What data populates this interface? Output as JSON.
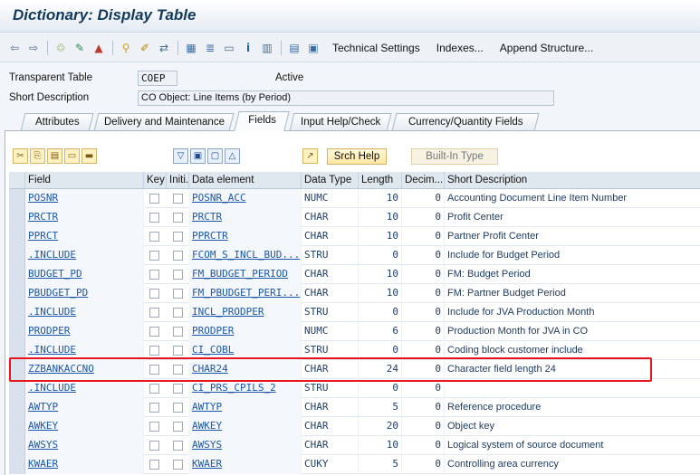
{
  "window": {
    "title": "Dictionary: Display Table"
  },
  "toolbar": {
    "icons": [
      "back-arrow-icon",
      "forward-arrow-icon",
      "other-object-icon",
      "display-change-icon",
      "activate-icon",
      "where-used-icon",
      "edit-object-icon",
      "object-list-icon",
      "hierarchy-icon",
      "graphic-icon",
      "info-icon",
      "display-object-list-icon"
    ],
    "technical_settings": "Technical Settings",
    "indexes": "Indexes...",
    "append_structure": "Append Structure..."
  },
  "header": {
    "table_type_label": "Transparent Table",
    "table_name": "COEP",
    "status": "Active",
    "short_desc_label": "Short Description",
    "short_desc": "CO Object: Line Items (by Period)"
  },
  "tabs": [
    "Attributes",
    "Delivery and Maintenance",
    "Fields",
    "Input Help/Check",
    "Currency/Quantity Fields"
  ],
  "active_tab": "Fields",
  "table_toolbar": {
    "srch_help": "Srch Help",
    "built_in_type": "Built-In Type"
  },
  "columns": [
    "Field",
    "Key",
    "Initi...",
    "Data element",
    "Data Type",
    "Length",
    "Decim...",
    "Short Description"
  ],
  "rows": [
    {
      "field": "POSNR",
      "key": false,
      "init": false,
      "element": "POSNR_ACC",
      "type": "NUMC",
      "length": "10",
      "decimals": "0",
      "desc": "Accounting Document Line Item Number"
    },
    {
      "field": "PRCTR",
      "key": false,
      "init": false,
      "element": "PRCTR",
      "type": "CHAR",
      "length": "10",
      "decimals": "0",
      "desc": "Profit Center"
    },
    {
      "field": "PPRCT",
      "key": false,
      "init": false,
      "element": "PPRCTR",
      "type": "CHAR",
      "length": "10",
      "decimals": "0",
      "desc": "Partner Profit Center"
    },
    {
      "field": ".INCLUDE",
      "key": false,
      "init": false,
      "element": "FCOM_S_INCL_BUD...",
      "type": "STRU",
      "length": "0",
      "decimals": "0",
      "desc": "Include for Budget Period"
    },
    {
      "field": "BUDGET_PD",
      "key": false,
      "init": false,
      "element": "FM_BUDGET_PERIOD",
      "type": "CHAR",
      "length": "10",
      "decimals": "0",
      "desc": "FM: Budget Period"
    },
    {
      "field": "PBUDGET_PD",
      "key": false,
      "init": false,
      "element": "FM_PBUDGET_PERI...",
      "type": "CHAR",
      "length": "10",
      "decimals": "0",
      "desc": "FM: Partner Budget Period"
    },
    {
      "field": ".INCLUDE",
      "key": false,
      "init": false,
      "element": "INCL_PRODPER",
      "type": "STRU",
      "length": "0",
      "decimals": "0",
      "desc": "Include for JVA Production Month"
    },
    {
      "field": "PRODPER",
      "key": false,
      "init": false,
      "element": "PRODPER",
      "type": "NUMC",
      "length": "6",
      "decimals": "0",
      "desc": "Production Month for JVA in CO"
    },
    {
      "field": ".INCLUDE",
      "key": false,
      "init": false,
      "element": "CI_COBL",
      "type": "STRU",
      "length": "0",
      "decimals": "0",
      "desc": "Coding block customer include"
    },
    {
      "field": "ZZBANKACCNO",
      "key": false,
      "init": false,
      "element": "CHAR24",
      "type": "CHAR",
      "length": "24",
      "decimals": "0",
      "desc": "Character field length 24"
    },
    {
      "field": ".INCLUDE",
      "key": false,
      "init": false,
      "element": "CI_PRS_CPILS_2",
      "type": "STRU",
      "length": "0",
      "decimals": "0",
      "desc": ""
    },
    {
      "field": "AWTYP",
      "key": false,
      "init": false,
      "element": "AWTYP",
      "type": "CHAR",
      "length": "5",
      "decimals": "0",
      "desc": "Reference procedure"
    },
    {
      "field": "AWKEY",
      "key": false,
      "init": false,
      "element": "AWKEY",
      "type": "CHAR",
      "length": "20",
      "decimals": "0",
      "desc": "Object key"
    },
    {
      "field": "AWSYS",
      "key": false,
      "init": false,
      "element": "AWSYS",
      "type": "CHAR",
      "length": "10",
      "decimals": "0",
      "desc": "Logical system of source document"
    },
    {
      "field": "KWAER",
      "key": false,
      "init": false,
      "element": "KWAER",
      "type": "CUKY",
      "length": "5",
      "decimals": "0",
      "desc": "Controlling area currency"
    }
  ],
  "colors": {
    "highlight": "#e8141b",
    "title": "#123a5c",
    "link": "#1a57a8"
  }
}
